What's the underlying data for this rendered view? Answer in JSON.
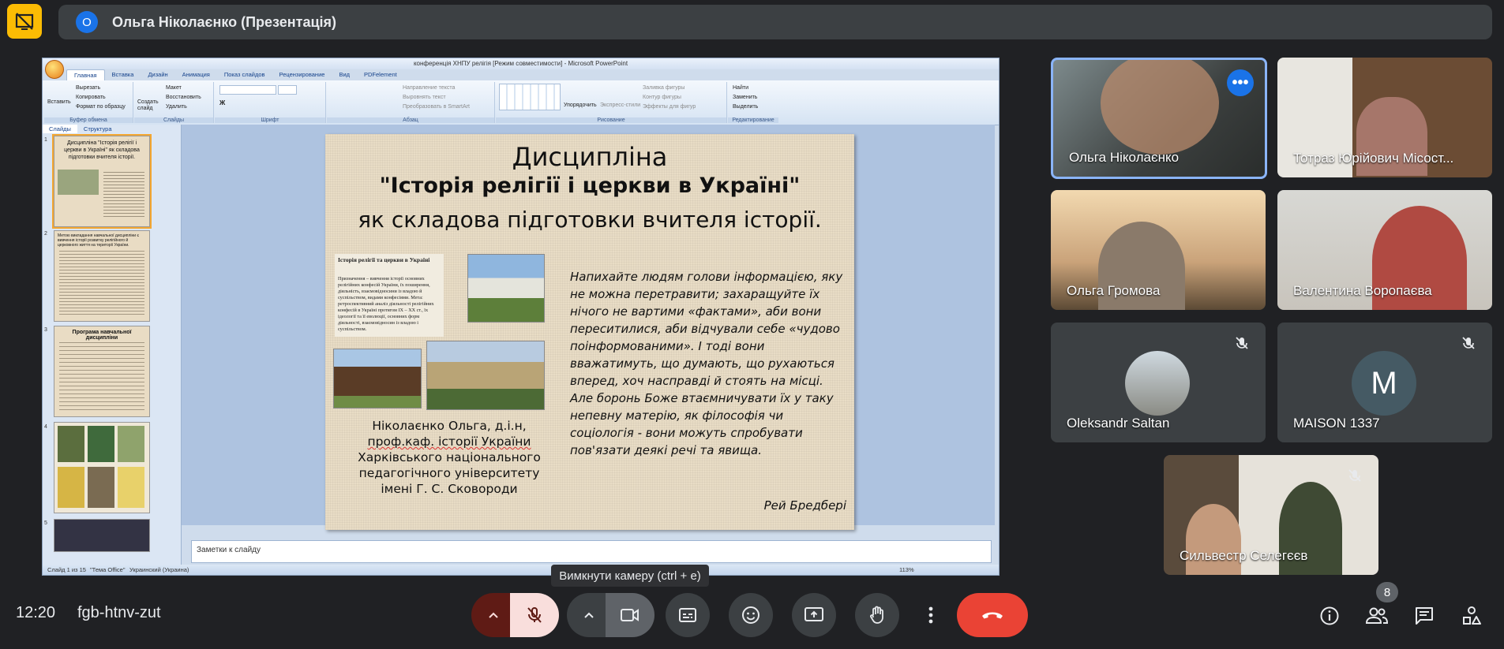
{
  "top_bar": {
    "presenter_avatar_letter": "О",
    "presenter_title": "Ольга Ніколаєнко (Презентація)"
  },
  "powerpoint": {
    "window_title": "конференція ХНПУ релігія [Режим совместимости] - Microsoft PowerPoint",
    "tabs": [
      "Главная",
      "Вставка",
      "Дизайн",
      "Анимация",
      "Показ слайдов",
      "Рецензирование",
      "Вид",
      "PDFelement"
    ],
    "ribbon": {
      "clipboard": {
        "paste": "Вставить",
        "cut": "Вырезать",
        "copy": "Копировать",
        "format": "Формат по образцу",
        "label": "Буфер обмена"
      },
      "slides": {
        "create": "Создать слайд",
        "layout": "Макет",
        "reset": "Восстановить",
        "delete": "Удалить",
        "label": "Слайды"
      },
      "font": {
        "label": "Шрифт"
      },
      "paragraph": {
        "direction": "Направление текста",
        "align": "Выровнять текст",
        "smartart": "Преобразовать в SmartArt",
        "label": "Абзац"
      },
      "drawing": {
        "arrange": "Упорядочить",
        "quick_styles": "Экспресс-стили",
        "fill": "Заливка фигуры",
        "outline": "Контур фигуры",
        "effects": "Эффекты для фигур",
        "label": "Рисование"
      },
      "editing": {
        "find": "Найти",
        "replace": "Заменить",
        "select": "Выделить",
        "label": "Редактирование"
      }
    },
    "panel_tabs": [
      "Слайды",
      "Структура"
    ],
    "thumbnails": [
      {
        "num": "1",
        "title": "Дисципліна \"Історія релігії і церкви в Україні\" як складова підготовки вчителя історії."
      },
      {
        "num": "2",
        "title": "Метою викладання навчальної дисципліни є вивчення історії розвитку релігійного й церковного життя на території України."
      },
      {
        "num": "3",
        "title": "Програма навчальної дисципліни"
      },
      {
        "num": "4",
        "title": ""
      },
      {
        "num": "5",
        "title": ""
      }
    ],
    "slide": {
      "title_line1": "Дисципліна",
      "title_line2": "\"Історія релігії і церкви в Україні\"",
      "title_line3": "як складова підготовки вчителя історії.",
      "inset_title": "Історія релігії та церкви в Україні",
      "inset_body": "Призначення – вивчення історії основних релігійних конфесій України, їх поширення, діяльність, взаємовідносини із владою й суспільством, видами конфесіями. Мета: ретроспективний аналіз діяльності релігійних конфесій в Україні протягом IX – XX ст., їх ідеології та її еволюції, основних форм діяльності, взаємовідносин із владою і суспільством.",
      "author_line1": "Ніколаєнко Ольга, д.і.н,",
      "author_line2": "проф.каф. історії України",
      "author_line3": "Харківського національного",
      "author_line4": "педагогічного університету",
      "author_line5": "імені Г. С. Сковороди",
      "quote": "Напихайте людям голови інформацією, яку не можна перетравити; захаращуйте їх нічого не вартими «фактами», аби вони переситилися, аби відчували себе «чудово поінформованими». І тоді вони вважатимуть, що думають, що рухаються вперед, хоч насправді й стоять на місці. Але боронь Боже втаємничувати їх у таку непевну матерію, як філософія чи соціологія - вони можуть спробувати пов'язати деякі речі та явища.",
      "quote_author": "Рей Бредбері"
    },
    "notes_placeholder": "Заметки к слайду",
    "status": {
      "slide": "Слайд 1 из 15",
      "theme": "\"Тема Office\"",
      "language": "Украинский (Украина)",
      "zoom": "113%"
    }
  },
  "participants": [
    {
      "name": "Ольга Ніколаєнко",
      "muted": false
    },
    {
      "name": "Тотраз Юрійович Місост...",
      "muted": false
    },
    {
      "name": "Ольга Громова",
      "muted": false
    },
    {
      "name": "Валентина Воропаєва",
      "muted": false
    },
    {
      "name": "Oleksandr Saltan",
      "muted": true
    },
    {
      "name": "MAISON 1337",
      "muted": true,
      "avatar_letter": "M"
    },
    {
      "name": "Сильвестр Селегєєв",
      "muted": true
    }
  ],
  "bottom_bar": {
    "clock": "12:20",
    "meeting_code": "fgb-htnv-zut",
    "tooltip": "Вимкнути камеру (ctrl + e)",
    "people_count": "8"
  },
  "colors": {
    "end_call": "#ea4335",
    "mic_off_bg": "#f9dedc",
    "accent": "#8ab4f8",
    "logo": "#fbbc04"
  }
}
